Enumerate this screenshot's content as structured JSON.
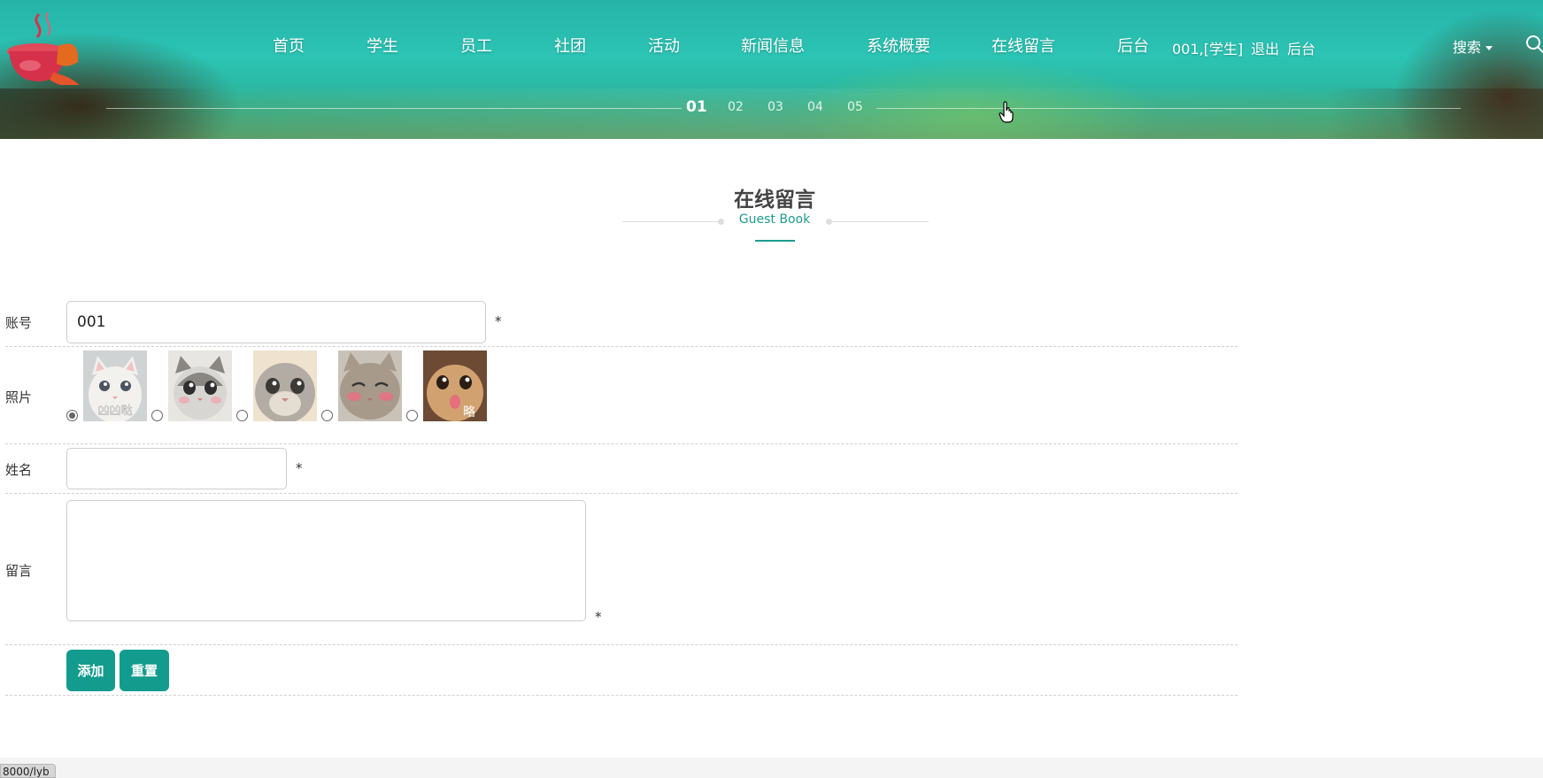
{
  "nav": {
    "items": [
      "首页",
      "学生",
      "员工",
      "社团",
      "活动",
      "新闻信息",
      "系统概要",
      "在线留言",
      "后台"
    ],
    "user": "001,[学生]",
    "logout": "退出",
    "admin": "后台",
    "search_label": "搜索"
  },
  "slider": {
    "dots": [
      "01",
      "02",
      "03",
      "04",
      "05"
    ],
    "active": "01"
  },
  "section": {
    "title": "在线留言",
    "subtitle": "Guest Book"
  },
  "form": {
    "account_label": "账号",
    "account_value": "001",
    "photo_label": "照片",
    "photos": [
      {
        "icon": "white-cat-photo",
        "caption": "凶凶哒",
        "selected": true
      },
      {
        "icon": "tabby-kitten-photo",
        "caption": "",
        "selected": false
      },
      {
        "icon": "gray-cat-photo",
        "caption": "",
        "selected": false
      },
      {
        "icon": "blushing-cat-photo",
        "caption": "",
        "selected": false
      },
      {
        "icon": "tongue-cat-photo",
        "caption": "略",
        "selected": false
      }
    ],
    "name_label": "姓名",
    "name_value": "",
    "message_label": "留言",
    "message_value": "",
    "required_mark": "*",
    "submit_label": "添加",
    "reset_label": "重置"
  },
  "status_bar": {
    "url": "8000/lyb"
  },
  "colors": {
    "accent": "#139c8d",
    "subtitle": "#1c9c8e",
    "header_teal": "#2cc4b4"
  }
}
